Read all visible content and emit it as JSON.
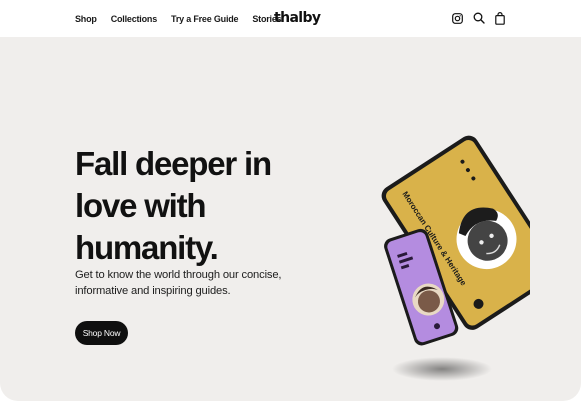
{
  "nav": {
    "items": [
      {
        "label": "Shop"
      },
      {
        "label": "Collections"
      },
      {
        "label": "Try a Free Guide"
      },
      {
        "label": "Stories"
      }
    ]
  },
  "brand": {
    "logo": "thalby"
  },
  "header_icons": [
    "instagram-icon",
    "search-icon",
    "bag-icon"
  ],
  "hero": {
    "headline": "Fall deeper in love with humanity.",
    "subtext": "Get to know the world through our concise, informative and inspiring guides.",
    "cta_label": "Shop Now"
  },
  "illustration": {
    "tablet_title": "Moroccan Culture & Heritage",
    "colors": {
      "tablet_screen": "#d9b24a",
      "phone_screen": "#b48ce0",
      "hero_bg": "#f0eeec"
    }
  }
}
